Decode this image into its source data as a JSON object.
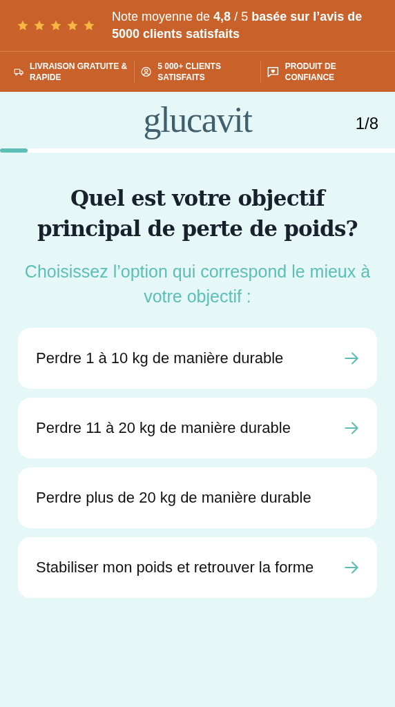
{
  "rating_banner": {
    "stars": 5,
    "text": "Note moyenne de **4,8** / 5 **basée sur l’avis de 5000 clients satisfaits**"
  },
  "features": [
    {
      "kind": "truck",
      "label": "LIVRAISON GRATUITE & RAPIDE"
    },
    {
      "kind": "user",
      "label": "5 000+ CLIENTS SATISFAITS"
    },
    {
      "kind": "heart",
      "label": "PRODUIT DE CONFIANCE"
    }
  ],
  "header": {
    "logo": "glucavit",
    "step": "1/8",
    "progress": {
      "level": 0.07
    }
  },
  "question": {
    "title": "Quel est votre objectif principal de perte de poids?",
    "subtitle": "Choisissez l’option qui correspond le mieux à votre objectif :"
  },
  "options": [
    {
      "label": "Perdre 1 à 10 kg de manière durable",
      "arrow": true
    },
    {
      "label": "Perdre 11 à 20 kg de manière durable",
      "arrow": true
    },
    {
      "label": "Perdre plus de 20 kg de manière durable",
      "arrow": false
    },
    {
      "label": "Stabiliser mon poids et retrouver la forme",
      "arrow": true
    }
  ]
}
